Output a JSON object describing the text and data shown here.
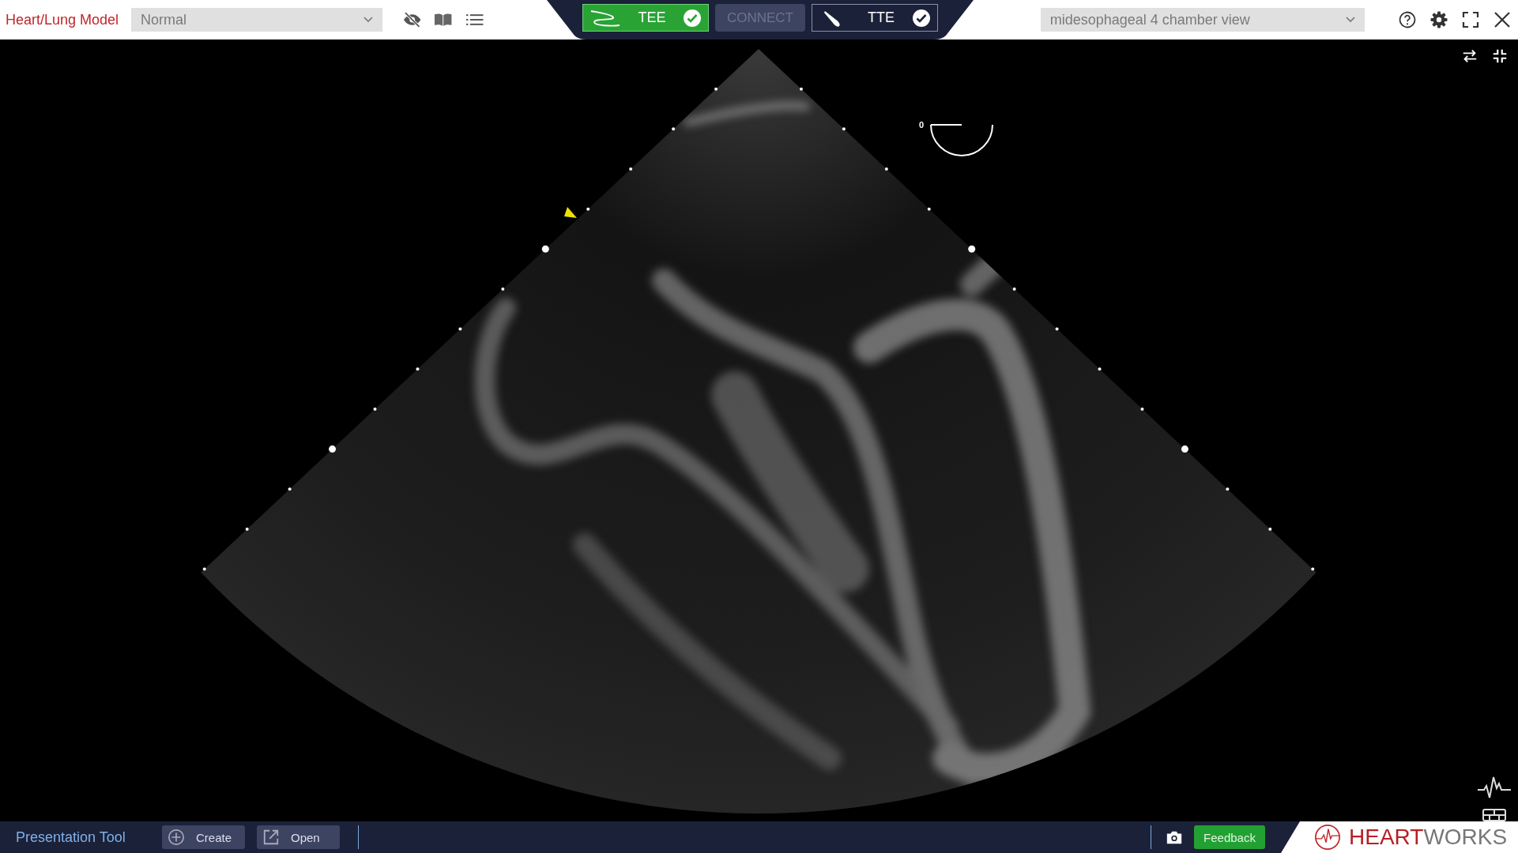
{
  "header": {
    "title": "Heart/Lung Model",
    "condition_select": {
      "value": "Normal"
    },
    "view_select": {
      "value": "midesophageal 4 chamber view"
    }
  },
  "probes": [
    {
      "kind": "probe",
      "label": "TEE",
      "selected": true,
      "connected": true
    },
    {
      "kind": "connect",
      "label": "CONNECT",
      "disabled": true
    },
    {
      "kind": "probe",
      "label": "TTE",
      "selected": false,
      "connected": true
    }
  ],
  "viewer": {
    "angle": "0"
  },
  "footer": {
    "title": "Presentation Tool",
    "buttons": [
      {
        "kind": "create",
        "label": "Create"
      },
      {
        "kind": "open",
        "label": "Open"
      }
    ],
    "feedback": "Feedback",
    "logo_primary": "HEART",
    "logo_secondary": "WORKS"
  }
}
